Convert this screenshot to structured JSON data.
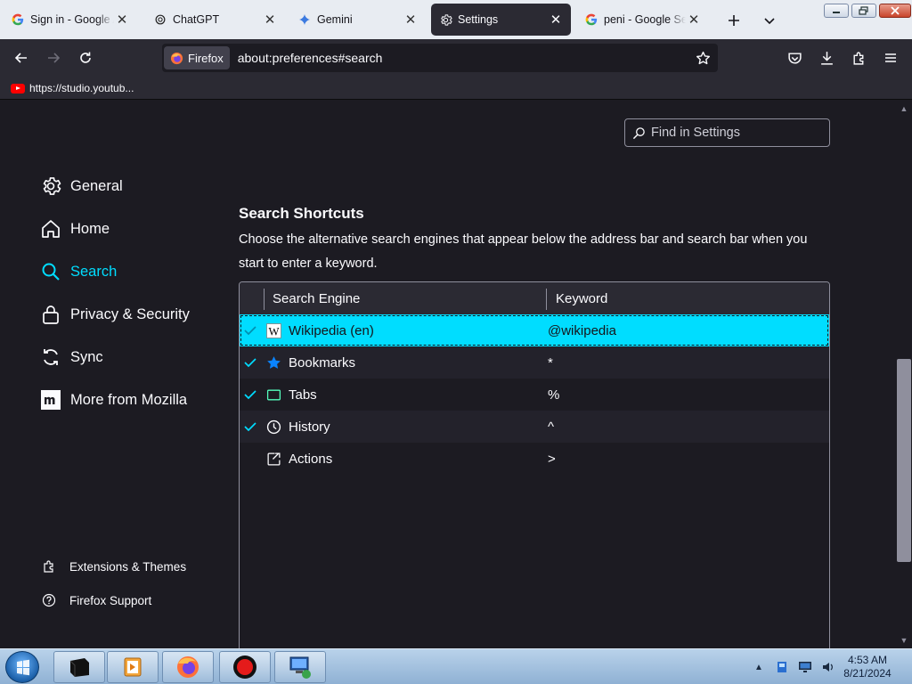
{
  "tabs": [
    {
      "title": "Sign in - Google Accounts",
      "favicon": "google-g-icon"
    },
    {
      "title": "ChatGPT",
      "favicon": "openai-icon"
    },
    {
      "title": "Gemini",
      "favicon": "gemini-sparkle-icon"
    },
    {
      "title": "Settings",
      "favicon": "gear-icon",
      "active": true
    },
    {
      "title": "peni - Google Search",
      "favicon": "google-g-icon"
    }
  ],
  "navbar": {
    "identity_label": "Firefox",
    "url": "about:preferences#search"
  },
  "bookmarks": [
    {
      "title": "https://studio.youtub...",
      "icon": "youtube-icon"
    }
  ],
  "search": {
    "placeholder": "Find in Settings"
  },
  "sidebar": {
    "categories": [
      {
        "label": "General",
        "icon": "gear-icon"
      },
      {
        "label": "Home",
        "icon": "home-icon"
      },
      {
        "label": "Search",
        "icon": "search-icon",
        "selected": true
      },
      {
        "label": "Privacy & Security",
        "icon": "lock-icon"
      },
      {
        "label": "Sync",
        "icon": "sync-icon"
      },
      {
        "label": "More from Mozilla",
        "icon": "mozilla-icon"
      }
    ],
    "footer": [
      {
        "label": "Extensions & Themes",
        "icon": "puzzle-icon"
      },
      {
        "label": "Firefox Support",
        "icon": "help-icon"
      }
    ]
  },
  "main": {
    "section_title": "Search Shortcuts",
    "section_desc": "Choose the alternative search engines that appear below the address bar and search bar when you start to enter a keyword.",
    "table": {
      "headers": [
        "Search Engine",
        "Keyword"
      ],
      "rows": [
        {
          "name": "Wikipedia (en)",
          "keyword": "@wikipedia",
          "checked": true,
          "icon": "wikipedia-icon",
          "selected": true
        },
        {
          "name": "Bookmarks",
          "keyword": "*",
          "checked": true,
          "icon": "star-icon"
        },
        {
          "name": "Tabs",
          "keyword": "%",
          "checked": true,
          "icon": "tab-icon"
        },
        {
          "name": "History",
          "keyword": "^",
          "checked": true,
          "icon": "clock-icon"
        },
        {
          "name": "Actions",
          "keyword": ">",
          "checked": false,
          "icon": "actions-icon"
        }
      ]
    }
  },
  "taskbar": {
    "time": "4:53 AM",
    "date": "8/21/2024"
  },
  "colors": {
    "accent": "#00ddff",
    "background": "#1c1b22",
    "toolbar": "#2b2a33",
    "text": "#fbfbfe"
  }
}
